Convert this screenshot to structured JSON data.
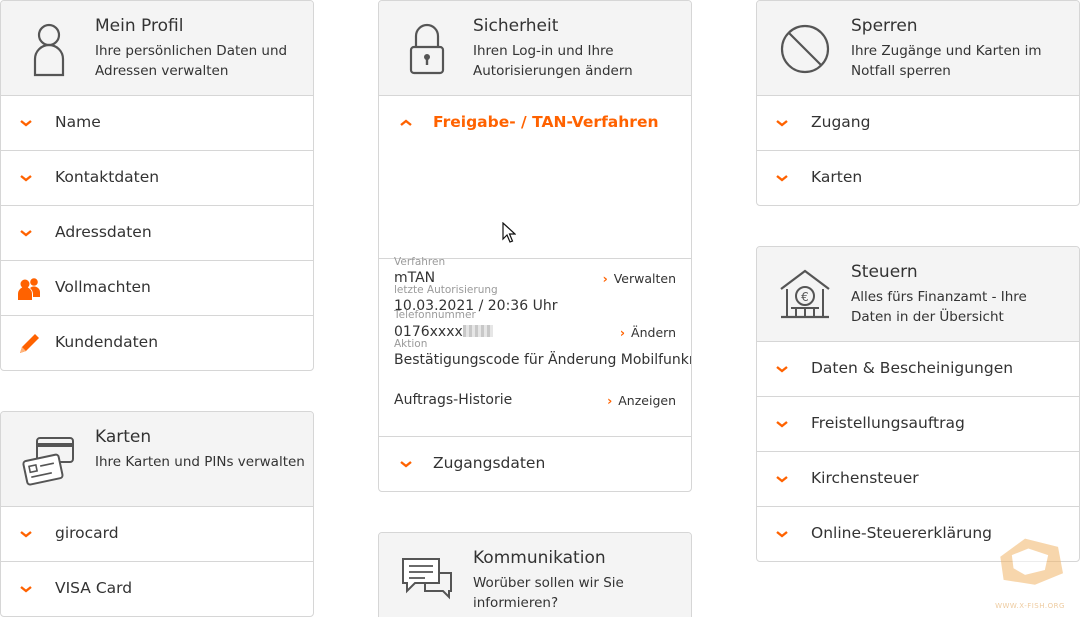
{
  "profil": {
    "title": "Mein Profil",
    "subtitle": "Ihre persönlichen Daten und Adressen verwalten",
    "items": [
      "Name",
      "Kontaktdaten",
      "Adressdaten",
      "Vollmachten",
      "Kundendaten"
    ]
  },
  "karten": {
    "title": "Karten",
    "subtitle": "Ihre Karten und PINs verwalten",
    "items": [
      "girocard",
      "VISA Card"
    ]
  },
  "sicherheit": {
    "title": "Sicherheit",
    "subtitle": "Ihren Log-in und Ihre Autorisierungen ändern",
    "open_section": "Freigabe- / TAN-Verfahren",
    "verfahren_label": "Verfahren",
    "verfahren_value": "mTAN",
    "verfahren_action": "Verwalten",
    "telefon_label": "Telefonnummer",
    "telefon_value": "0176xxxx",
    "telefon_action": "Ändern",
    "letzte_label": "letzte Autorisierung",
    "letzte_value": "10.03.2021 / 20:36 Uhr",
    "aktion_label": "Aktion",
    "aktion_value": "Bestätigungscode für Änderung Mobilfunkn...",
    "historie_label": "Auftrags-Historie",
    "historie_action": "Anzeigen",
    "zugangsdaten": "Zugangsdaten"
  },
  "kommunikation": {
    "title": "Kommunikation",
    "subtitle": "Worüber sollen wir Sie informieren?"
  },
  "sperren": {
    "title": "Sperren",
    "subtitle": "Ihre Zugänge und Karten im Notfall sperren",
    "items": [
      "Zugang",
      "Karten"
    ]
  },
  "steuern": {
    "title": "Steuern",
    "subtitle": "Alles fürs Finanzamt - Ihre Daten in der Übersicht",
    "items": [
      "Daten & Bescheinigungen",
      "Freistellungsauftrag",
      "Kirchensteuer",
      "Online-Steuererklärung"
    ]
  },
  "watermark": "WWW.X-FISH.ORG",
  "colors": {
    "accent": "#ff6200",
    "border": "#d6d6d6",
    "header_bg": "#f4f4f4"
  }
}
